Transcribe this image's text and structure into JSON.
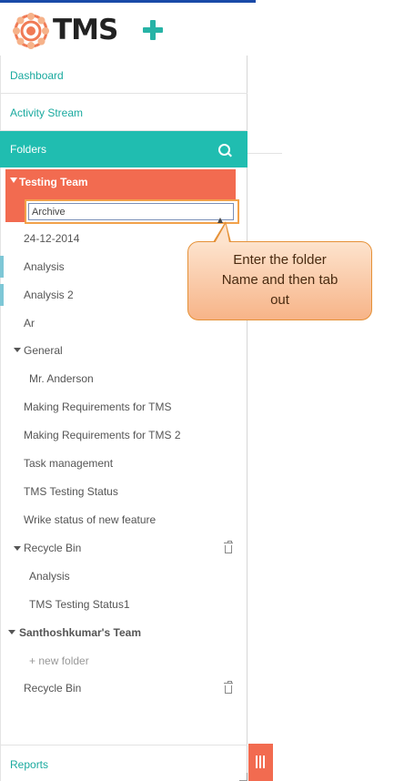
{
  "header": {
    "app_name": "TMS"
  },
  "nav": {
    "dashboard": "Dashboard",
    "activity_stream": "Activity Stream",
    "folders": "Folders",
    "reports": "Reports"
  },
  "tree": {
    "team1": "Testing Team",
    "editing_value": "Archive",
    "items": {
      "date": "24-12-2014",
      "analysis": "Analysis",
      "analysis2": "Analysis 2",
      "ar": "Ar",
      "general": "General",
      "mr_anderson": "Mr. Anderson",
      "making_req": "Making Requirements for TMS",
      "making_req2": "Making Requirements for TMS 2",
      "task_mgmt": "Task management",
      "tms_testing_status": "TMS Testing Status",
      "wrike_status": "Wrike status of new feature",
      "recycle_bin": "Recycle Bin",
      "rb_analysis": "Analysis",
      "rb_tms_status1": "TMS Testing Status1"
    },
    "team2": "Santhoshkumar's Team",
    "new_folder": "+ new folder",
    "team2_recycle_bin": "Recycle Bin"
  },
  "callout": {
    "text": "Enter the folder\nName and then tab\nout"
  },
  "colors": {
    "accent": "#20bdb0",
    "selected": "#f26b50",
    "callout_border": "#e59137"
  },
  "icons": [
    "tms-logo-icon",
    "plus-icon",
    "search-icon",
    "caret-down-icon",
    "trash-icon",
    "collapse-icon"
  ]
}
